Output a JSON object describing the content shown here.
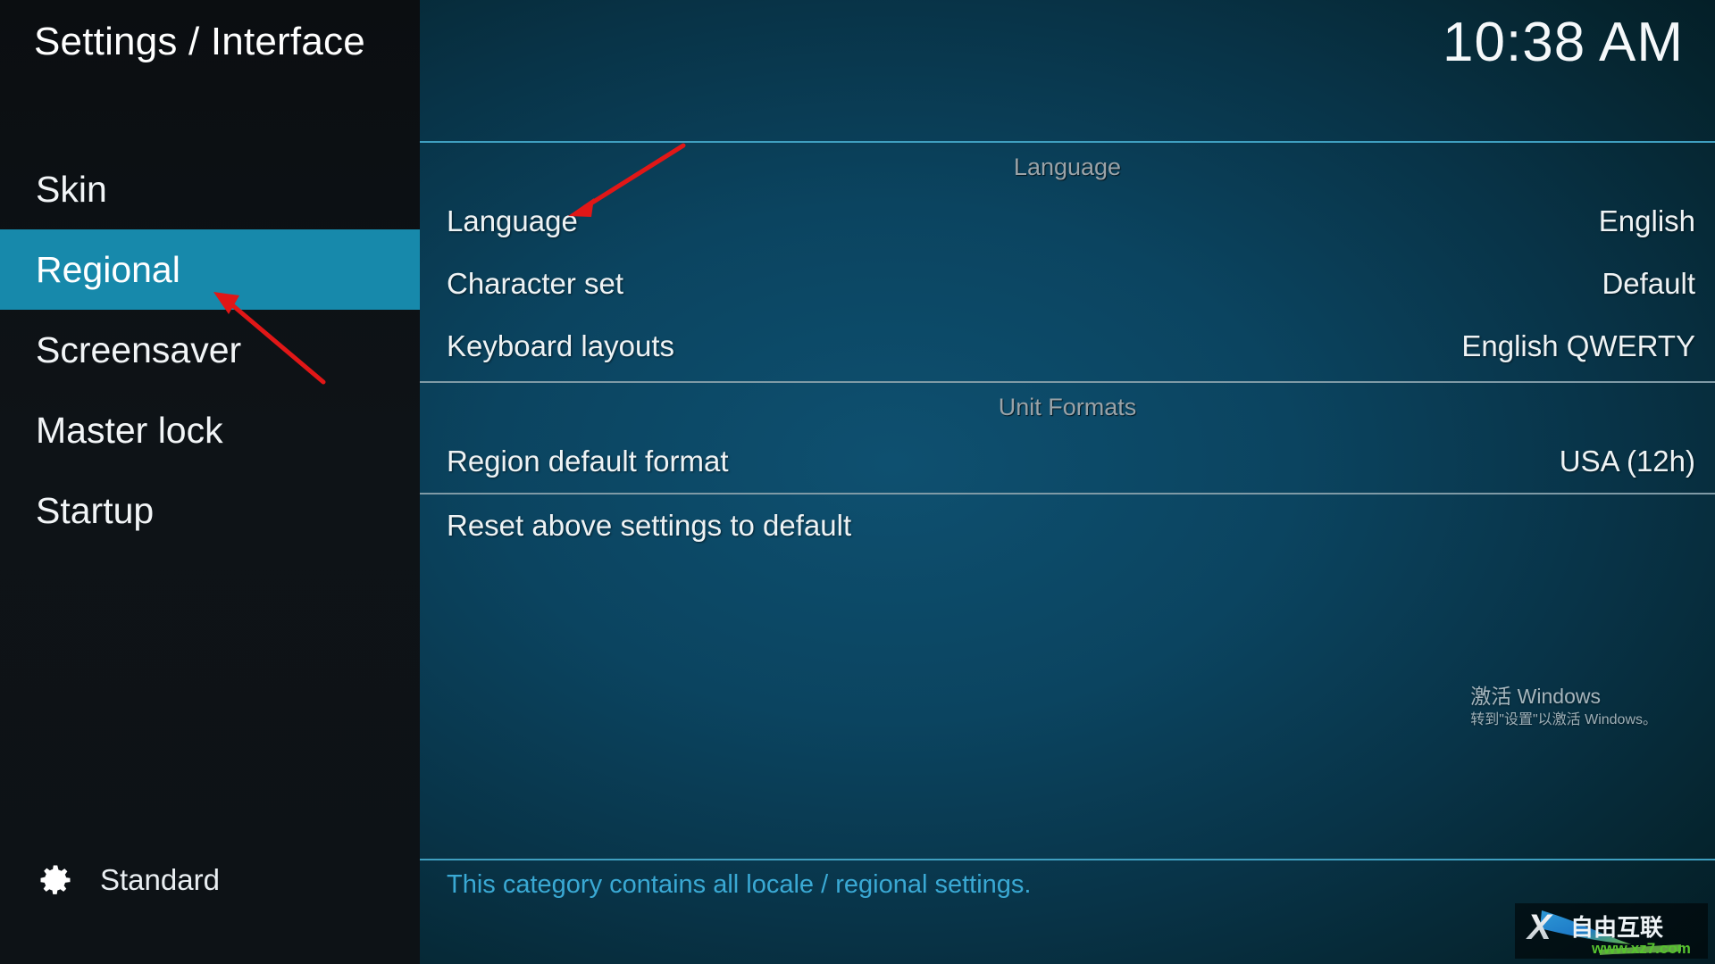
{
  "sidebar": {
    "title": "Settings / Interface",
    "items": [
      {
        "label": "Skin",
        "selected": false
      },
      {
        "label": "Regional",
        "selected": true
      },
      {
        "label": "Screensaver",
        "selected": false
      },
      {
        "label": "Master lock",
        "selected": false
      },
      {
        "label": "Startup",
        "selected": false
      }
    ],
    "profile": {
      "icon": "gear-icon",
      "label": "Standard"
    }
  },
  "header": {
    "clock": "10:38 AM"
  },
  "main": {
    "groups": [
      {
        "header": "Language",
        "rows": [
          {
            "label": "Language",
            "value": "English"
          },
          {
            "label": "Character set",
            "value": "Default"
          },
          {
            "label": "Keyboard layouts",
            "value": "English QWERTY"
          }
        ]
      },
      {
        "header": "Unit Formats",
        "rows": [
          {
            "label": "Region default format",
            "value": "USA (12h)"
          }
        ]
      }
    ],
    "reset_row": {
      "label": "Reset above settings to default",
      "value": ""
    }
  },
  "footer": {
    "description": "This category contains all locale / regional settings."
  },
  "watermark": {
    "title": "激活 Windows",
    "subtitle": "转到\"设置\"以激活 Windows。"
  },
  "site_logo": {
    "brand": "自由互联",
    "url": "www.xz7.com",
    "mark": "X"
  },
  "colors": {
    "accent": "#1789ab",
    "rule": "#3f9fc0",
    "footer_text": "#3aa9d4",
    "annotation": "#e11717",
    "group_header": "#9aa3a8"
  },
  "annotations": [
    {
      "name": "arrow-to-language-row",
      "points": "from (625,133) to (520,191)"
    },
    {
      "name": "arrow-to-regional-item",
      "points": "from (297,350) to (196,268)"
    }
  ]
}
